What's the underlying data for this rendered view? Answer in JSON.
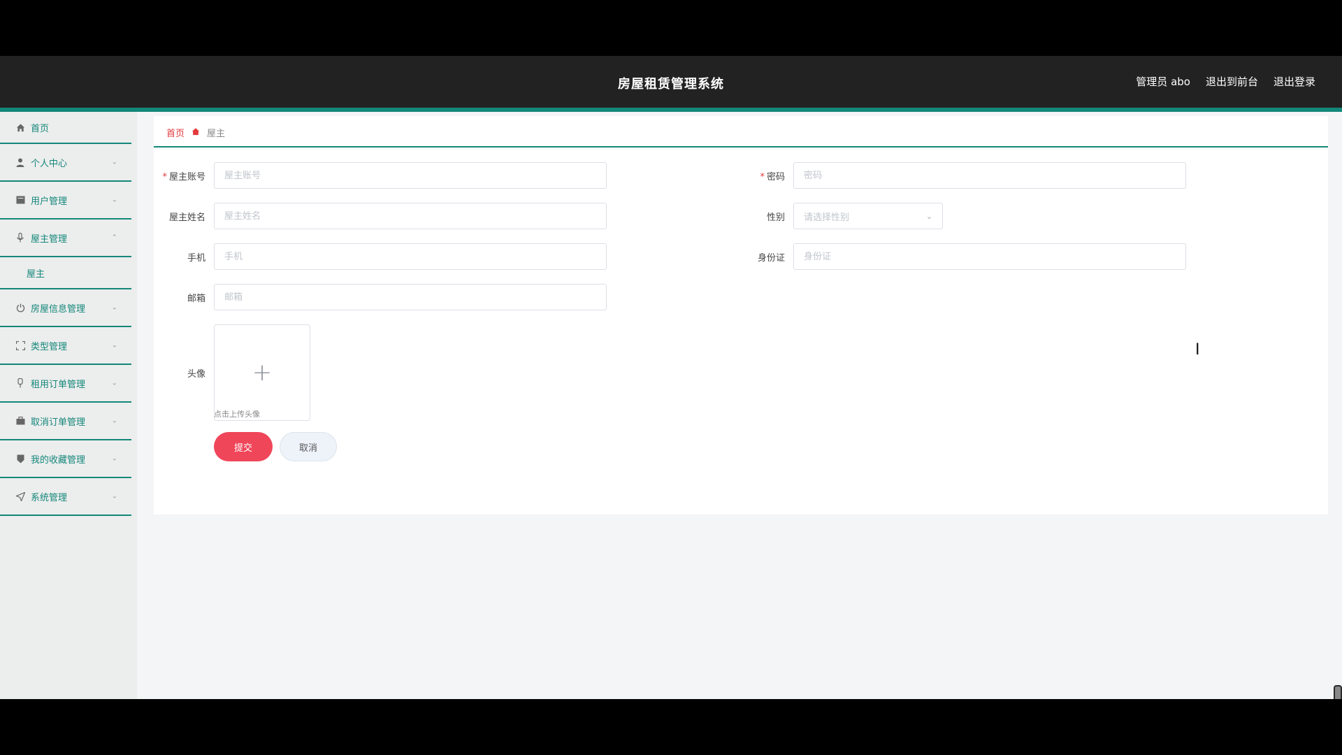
{
  "header": {
    "title": "房屋租赁管理系统",
    "user": "管理员 abo",
    "exit_front": "退出到前台",
    "logout": "退出登录"
  },
  "sidebar": {
    "items": [
      {
        "label": "首页",
        "icon": "home-icon",
        "expanded": false
      },
      {
        "label": "个人中心",
        "icon": "user-icon",
        "expanded": false
      },
      {
        "label": "用户管理",
        "icon": "users-icon",
        "expanded": false
      },
      {
        "label": "屋主管理",
        "icon": "mic-icon",
        "expanded": true
      },
      {
        "label": "房屋信息管理",
        "icon": "power-icon",
        "expanded": false
      },
      {
        "label": "类型管理",
        "icon": "expand-icon",
        "expanded": false
      },
      {
        "label": "租用订单管理",
        "icon": "pin-icon",
        "expanded": false
      },
      {
        "label": "取消订单管理",
        "icon": "briefcase-icon",
        "expanded": false
      },
      {
        "label": "我的收藏管理",
        "icon": "bookmark-icon",
        "expanded": false
      },
      {
        "label": "系统管理",
        "icon": "send-icon",
        "expanded": false
      }
    ],
    "sub_items": {
      "owner": "屋主"
    }
  },
  "breadcrumb": {
    "home": "首页",
    "current": "屋主"
  },
  "form": {
    "account": {
      "label": "屋主账号",
      "placeholder": "屋主账号",
      "value": "",
      "required": true
    },
    "password": {
      "label": "密码",
      "placeholder": "密码",
      "value": "",
      "required": true
    },
    "name": {
      "label": "屋主姓名",
      "placeholder": "屋主姓名",
      "value": ""
    },
    "gender": {
      "label": "性别",
      "placeholder": "请选择性别"
    },
    "phone": {
      "label": "手机",
      "placeholder": "手机",
      "value": ""
    },
    "id_card": {
      "label": "身份证",
      "placeholder": "身份证",
      "value": ""
    },
    "email": {
      "label": "邮箱",
      "placeholder": "邮箱",
      "value": ""
    },
    "avatar": {
      "label": "头像",
      "tip": "点击上传头像"
    },
    "submit": "提交",
    "cancel": "取消"
  },
  "colors": {
    "accent": "#13877a",
    "header_bg": "#222222",
    "submit_bg": "#f0465a"
  }
}
